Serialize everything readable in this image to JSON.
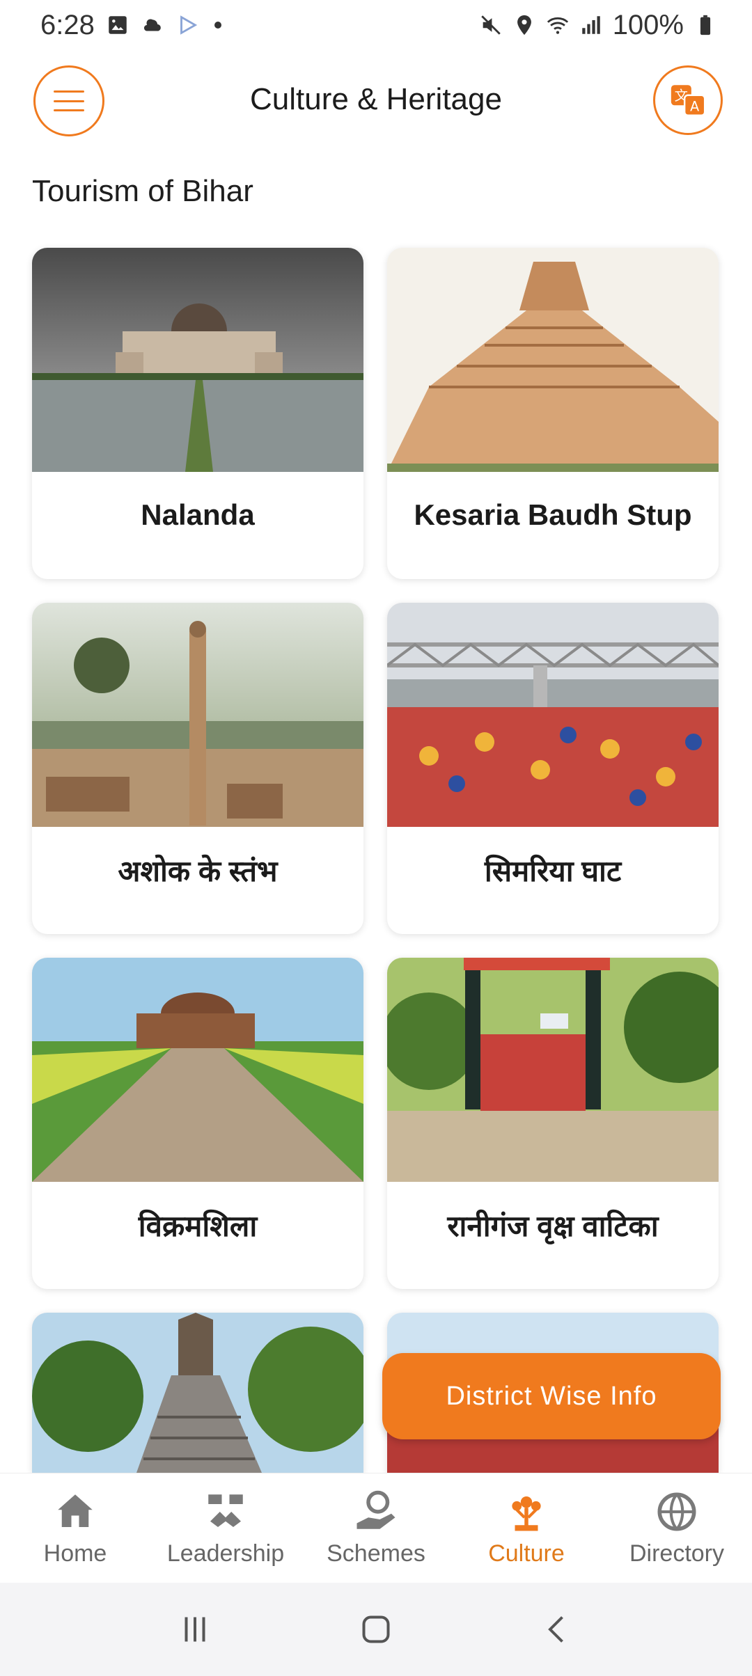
{
  "status_bar": {
    "time": "6:28",
    "battery": "100%"
  },
  "header": {
    "title": "Culture & Heritage"
  },
  "section": {
    "heading": "Tourism of Bihar"
  },
  "cards": [
    {
      "label": "Nalanda"
    },
    {
      "label": "Kesaria Baudh Stup"
    },
    {
      "label": "अशोक के स्तंभ"
    },
    {
      "label": "सिमरिया घाट"
    },
    {
      "label": "विक्रमशिला"
    },
    {
      "label": "रानीगंज वृक्ष वाटिका"
    }
  ],
  "fab": {
    "label": "District Wise Info"
  },
  "bottom_nav": {
    "items": [
      {
        "label": "Home",
        "icon": "home-icon"
      },
      {
        "label": "Leadership",
        "icon": "leadership-icon"
      },
      {
        "label": "Schemes",
        "icon": "schemes-icon"
      },
      {
        "label": "Culture",
        "icon": "culture-icon",
        "active": true
      },
      {
        "label": "Directory",
        "icon": "directory-icon"
      }
    ]
  },
  "colors": {
    "accent": "#f07a1e",
    "active_label": "#e07a1a",
    "inactive": "#666666"
  }
}
